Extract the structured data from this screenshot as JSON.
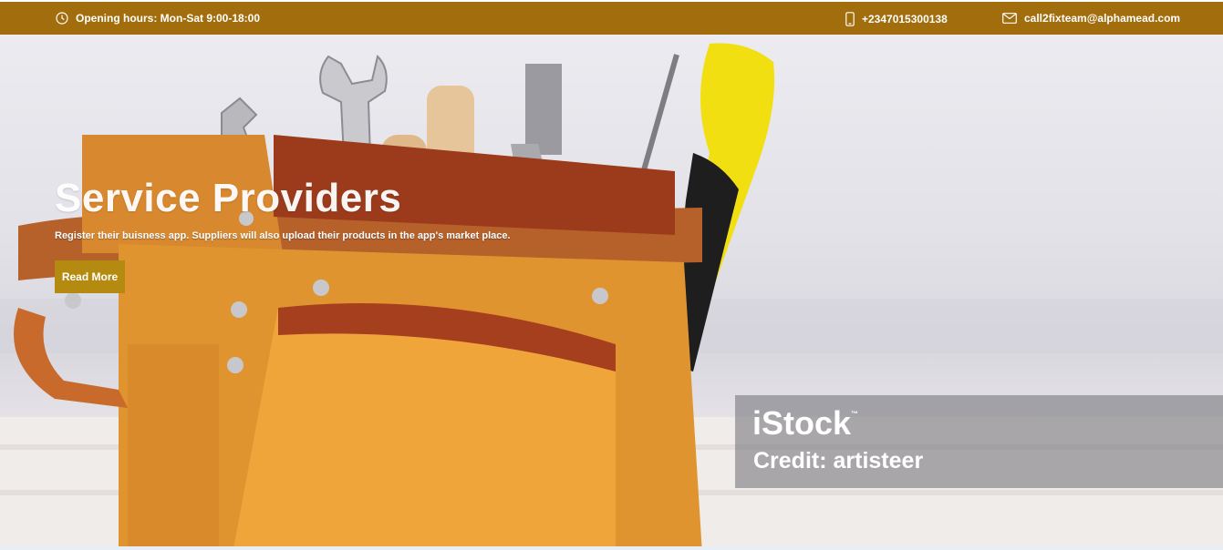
{
  "topbar": {
    "hours": "Opening hours: Mon-Sat 9:00-18:00",
    "phone": "+2347015300138",
    "email": "call2fixteam@alphamead.com",
    "icons": {
      "hours": "clock-icon",
      "phone": "mobile-phone-icon",
      "email": "envelope-icon"
    },
    "background": "#a26d0c"
  },
  "hero": {
    "title": "Service Providers",
    "subtitle": "Register their buisness app. Suppliers will also upload their products in the app's market place.",
    "button_label": "Read More",
    "button_color": "#b58a10",
    "image": "tool-belt-photo"
  },
  "watermark": {
    "brand": "iStock",
    "tm": "™",
    "credit": "Credit: artisteer"
  }
}
